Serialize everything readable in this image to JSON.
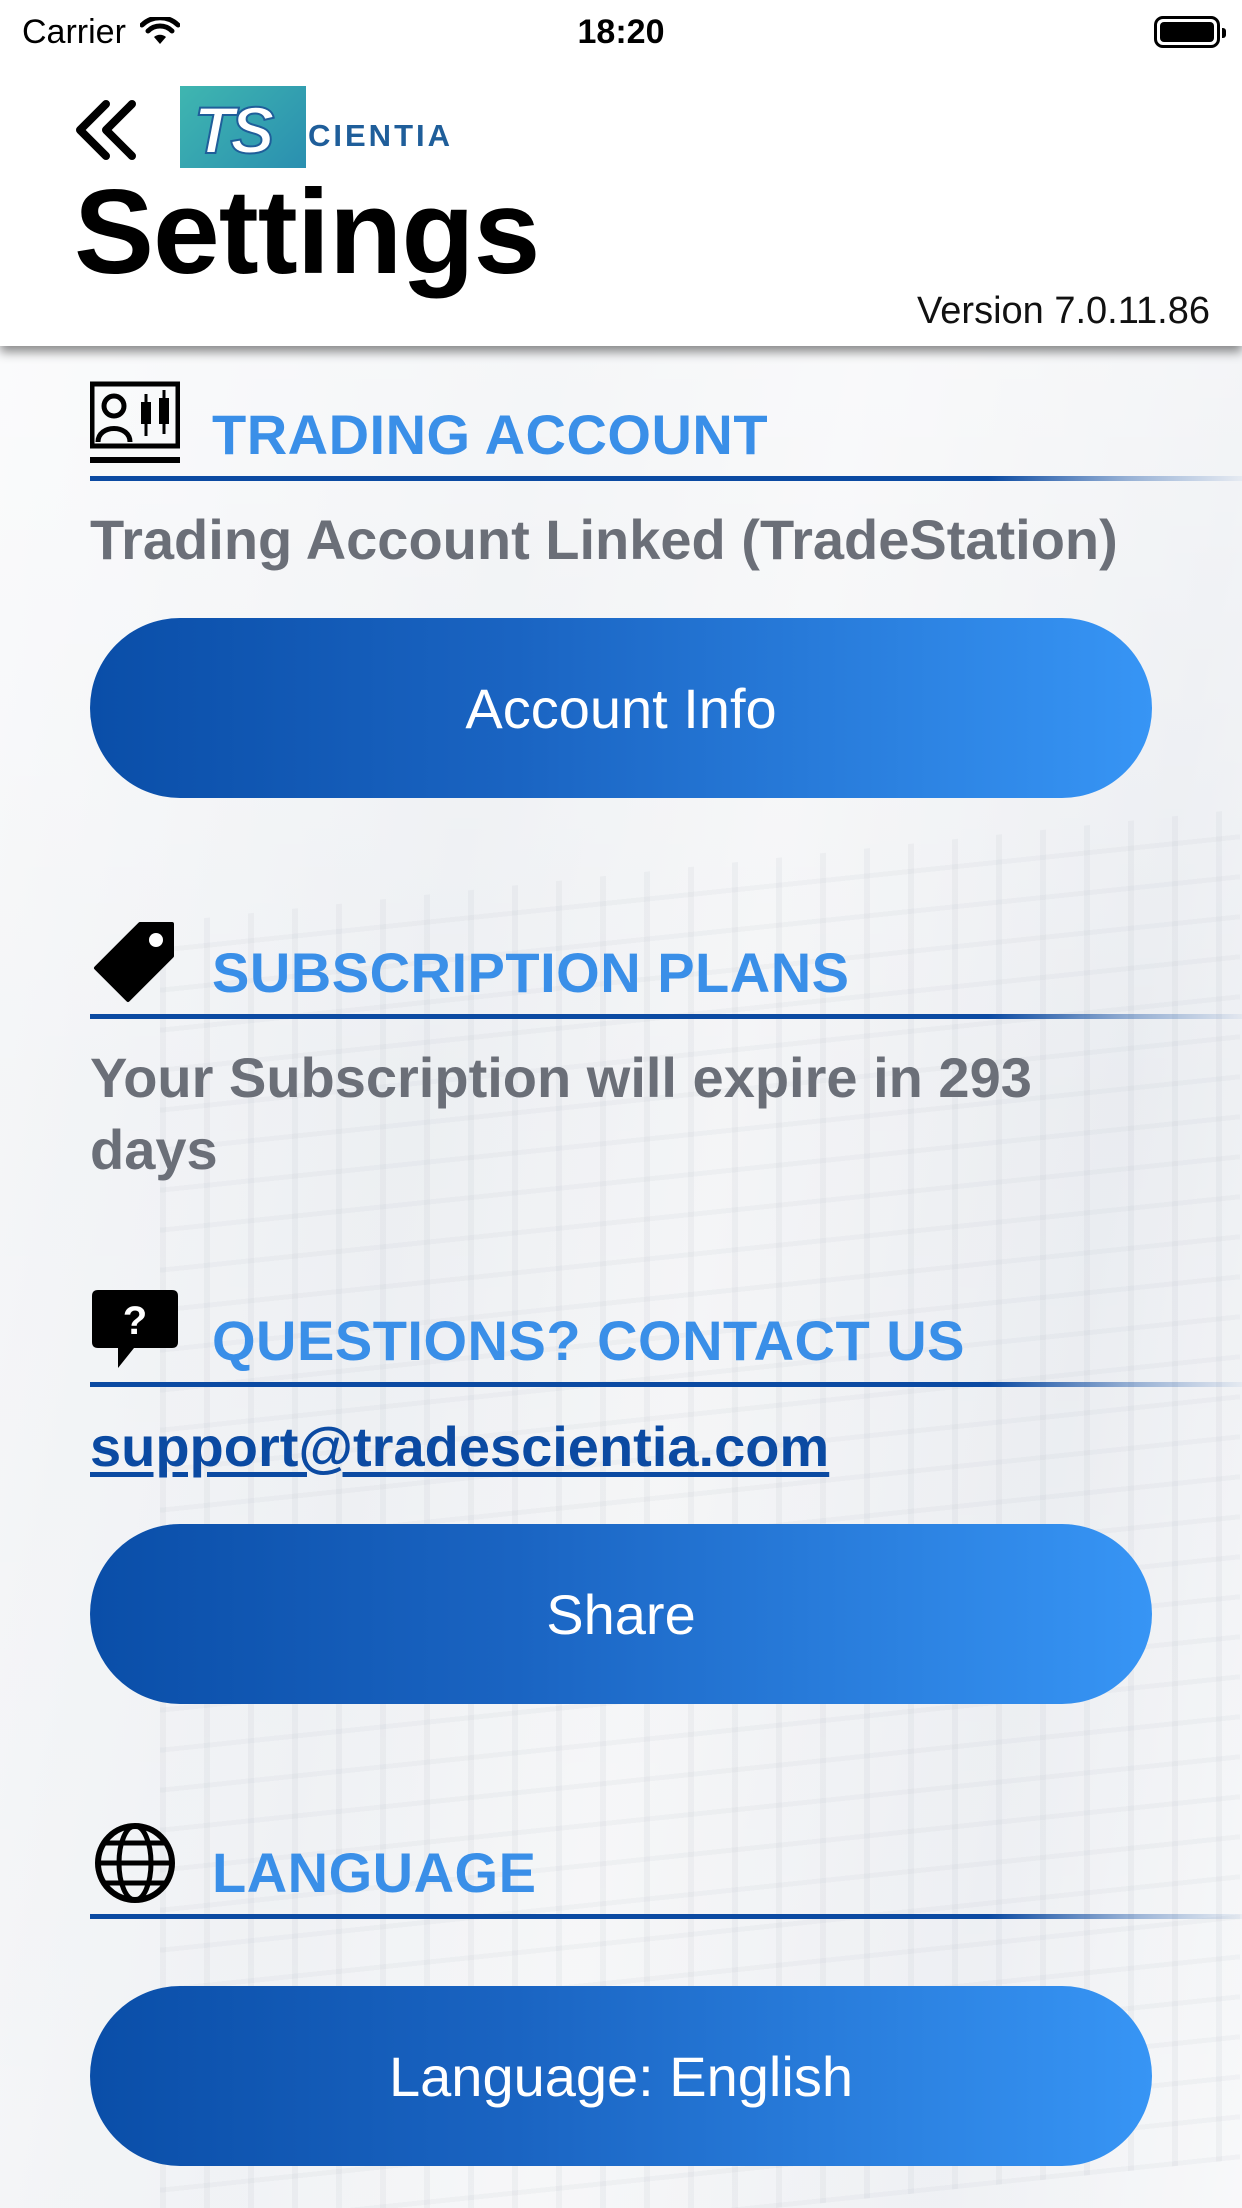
{
  "status_bar": {
    "carrier": "Carrier",
    "time": "18:20"
  },
  "header": {
    "back_icon": "double-chevron-left-icon",
    "logo_mark": "TS",
    "logo_text": "CIENTIA",
    "title": "Settings",
    "version": "Version 7.0.11.86"
  },
  "sections": {
    "trading": {
      "icon": "trading-account-icon",
      "title": "TRADING ACCOUNT",
      "status": "Trading Account Linked (TradeStation)",
      "button": "Account Info"
    },
    "subscription": {
      "icon": "price-tag-icon",
      "title": "SUBSCRIPTION PLANS",
      "status": "Your Subscription will expire in 293 days"
    },
    "contact": {
      "icon": "question-bubble-icon",
      "title": "QUESTIONS? CONTACT US",
      "email": "support@tradescientia.com",
      "button": "Share"
    },
    "language": {
      "icon": "globe-icon",
      "title": "LANGUAGE",
      "button": "Language: English"
    }
  },
  "colors": {
    "accent_title": "#3a8fe8",
    "rule": "#0b4aa2",
    "button_start": "#0a4ea8",
    "button_end": "#3795f5",
    "muted_text": "#6b6f78"
  }
}
